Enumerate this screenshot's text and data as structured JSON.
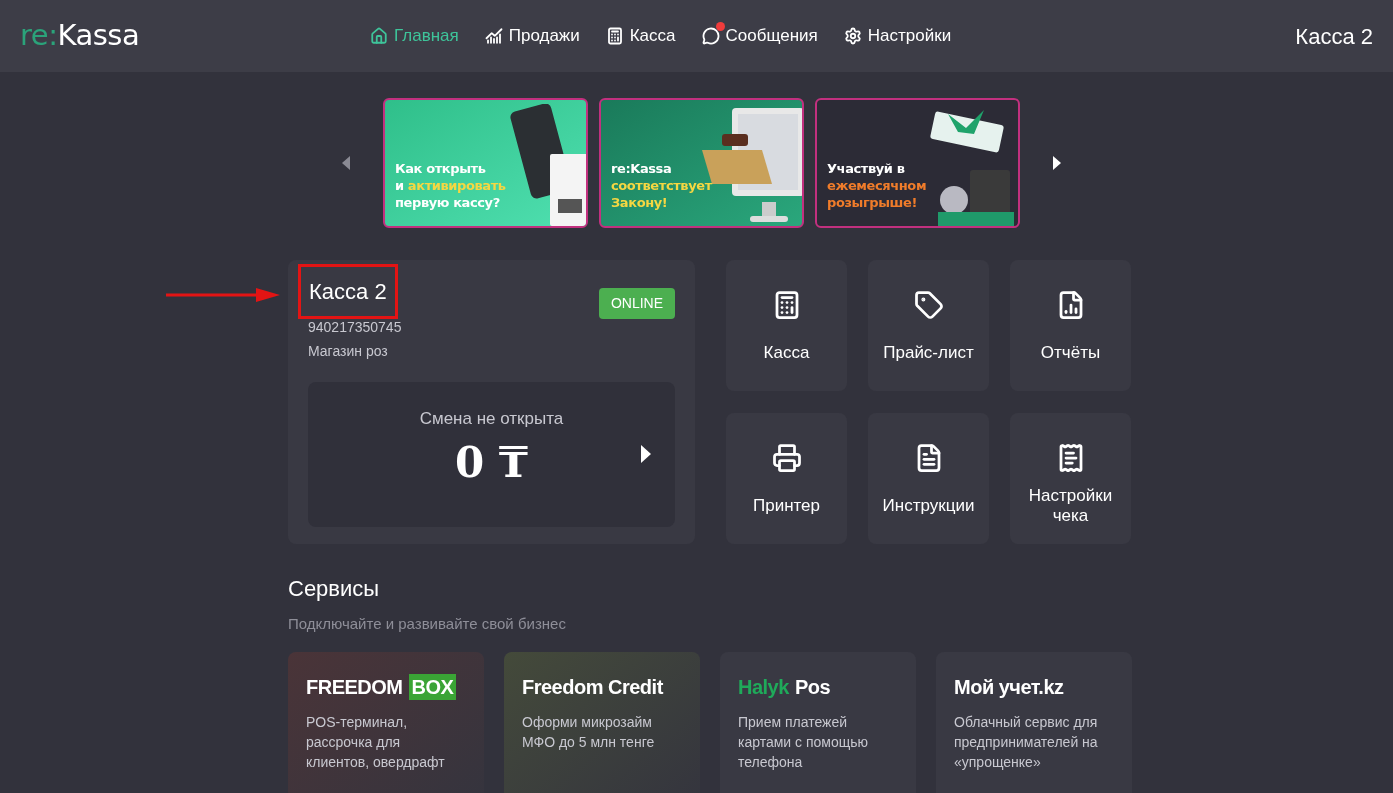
{
  "header": {
    "logo": {
      "prefix": "re:",
      "name": "Kassa"
    },
    "nav": [
      {
        "label": "Главная",
        "selected": true,
        "unread": false
      },
      {
        "label": "Продажи",
        "selected": false,
        "unread": false
      },
      {
        "label": "Касса",
        "selected": false,
        "unread": false
      },
      {
        "label": "Сообщения",
        "selected": false,
        "unread": true
      },
      {
        "label": "Настройки",
        "selected": false,
        "unread": false
      }
    ],
    "register_name": "Касса 2"
  },
  "banners": [
    {
      "color": "#f5d742",
      "lines": [
        [
          {
            "text": "Как открыть",
            "accent": false
          }
        ],
        [
          {
            "text": "и ",
            "accent": false
          },
          {
            "text": "активировать",
            "accent": true
          }
        ],
        [
          {
            "text": "первую кассу?",
            "accent": false
          }
        ]
      ]
    },
    {
      "color": "#f5d742",
      "lines": [
        [
          {
            "text": "re:Kassa",
            "accent": false
          }
        ],
        [
          {
            "text": "соответствует",
            "accent": true
          }
        ],
        [
          {
            "text": "Закону!",
            "accent": true
          }
        ]
      ]
    },
    {
      "color": "#f07c2a",
      "lines": [
        [
          {
            "text": "Участвуй в",
            "accent": false
          }
        ],
        [
          {
            "text": "ежемесячном",
            "accent": true
          }
        ],
        [
          {
            "text": "розыгрыше!",
            "accent": true
          }
        ]
      ]
    }
  ],
  "register": {
    "name": "Касса 2",
    "highlighted": true,
    "status": "ONLINE",
    "online": true,
    "number": "940217350745",
    "shop": "Магазин роз",
    "shift": {
      "label": "Смена не открыта",
      "amount": "0",
      "currency": "₸"
    }
  },
  "tiles": [
    {
      "label": "Касса"
    },
    {
      "label": "Прайс-лист"
    },
    {
      "label": "Отчёты"
    },
    {
      "label": "Принтер"
    },
    {
      "label": "Инструкции"
    },
    {
      "label": "Настройки чека"
    }
  ],
  "services": {
    "title": "Сервисы",
    "subtitle": "Подключайте и развивайте свой бизнес",
    "items": [
      {
        "title": [
          {
            "text": "FREEDOM",
            "kind": "plain"
          },
          {
            "text": "BOX",
            "kind": "boxed"
          }
        ],
        "description": "POS-терминал, рассрочка для клиентов, овердрафт"
      },
      {
        "title": [
          {
            "text": "Freedom Credit",
            "kind": "plain"
          }
        ],
        "description": "Оформи микрозайм МФО до 5 млн тенге"
      },
      {
        "title": [
          {
            "text": "Halyk",
            "kind": "green"
          },
          {
            "text": "Pos",
            "kind": "plain"
          }
        ],
        "description": "Прием платежей картами с помощью телефона"
      },
      {
        "title": [
          {
            "text": "Мой учет.kz",
            "kind": "bold"
          }
        ],
        "description": "Облачный сервис для предпринимателей на «упрощенке»"
      }
    ]
  }
}
